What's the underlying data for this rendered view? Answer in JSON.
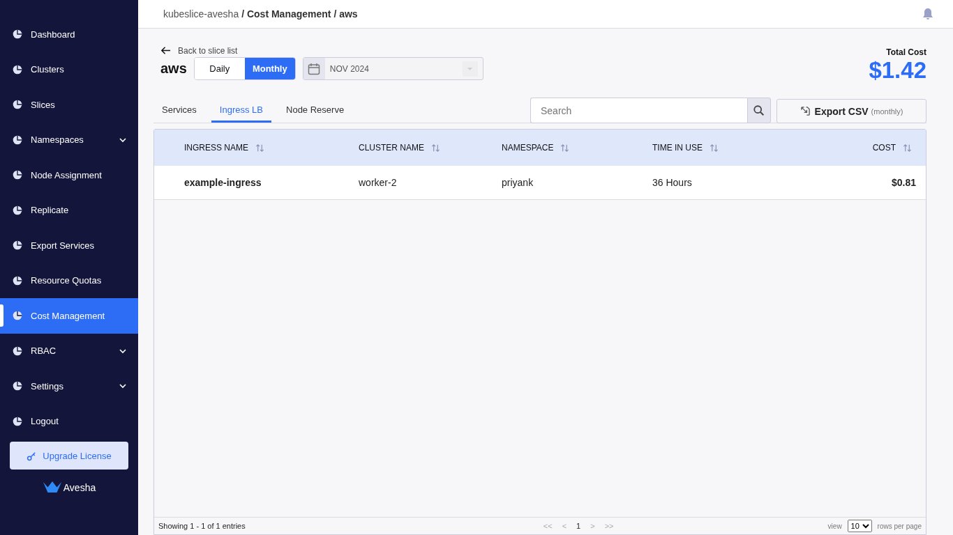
{
  "sidebar": {
    "items": [
      {
        "label": "Dashboard",
        "selected": false,
        "has_submenu": false
      },
      {
        "label": "Clusters",
        "selected": false,
        "has_submenu": false
      },
      {
        "label": "Slices",
        "selected": false,
        "has_submenu": false
      },
      {
        "label": "Namespaces",
        "selected": false,
        "has_submenu": true
      },
      {
        "label": "Node Assignment",
        "selected": false,
        "has_submenu": false
      },
      {
        "label": "Replicate",
        "selected": false,
        "has_submenu": false
      },
      {
        "label": "Export Services",
        "selected": false,
        "has_submenu": false
      },
      {
        "label": "Resource Quotas",
        "selected": false,
        "has_submenu": false
      },
      {
        "label": "Cost Management",
        "selected": true,
        "has_submenu": false
      },
      {
        "label": "RBAC",
        "selected": false,
        "has_submenu": true
      },
      {
        "label": "Settings",
        "selected": false,
        "has_submenu": true
      },
      {
        "label": "Logout",
        "selected": false,
        "has_submenu": false
      }
    ],
    "upgrade_button": "Upgrade License",
    "logo": "Avesha"
  },
  "breadcrumb": {
    "root": "kubeslice-avesha",
    "path": "/ Cost Management / aws"
  },
  "back_link": "Back to slice list",
  "slice_name": "aws",
  "period_toggle": [
    {
      "label": "Daily",
      "selected": false
    },
    {
      "label": "Monthly",
      "selected": true
    }
  ],
  "month_picker": {
    "value": "NOV 2024"
  },
  "total_cost": {
    "label": "Total Cost",
    "value": "$1.42"
  },
  "tabs": [
    {
      "label": "Services",
      "selected": false
    },
    {
      "label": "Ingress LB",
      "selected": true
    },
    {
      "label": "Node Reserve",
      "selected": false
    }
  ],
  "search": {
    "placeholder": "Search"
  },
  "export_button": {
    "label": "Export CSV",
    "note": "(monthly)"
  },
  "table": {
    "columns": [
      "INGRESS NAME",
      "CLUSTER NAME",
      "NAMESPACE",
      "TIME IN USE",
      "COST"
    ],
    "rows": [
      [
        "example-ingress",
        "worker-2",
        "priyank",
        "36 Hours",
        "$0.81"
      ]
    ]
  },
  "footer": {
    "summary": "Showing 1 - 1 of 1 entries",
    "pager": [
      "<<",
      "<",
      "1",
      ">",
      ">>"
    ],
    "view_label": "view",
    "page_size": "10",
    "rows_label": "rows per page"
  }
}
